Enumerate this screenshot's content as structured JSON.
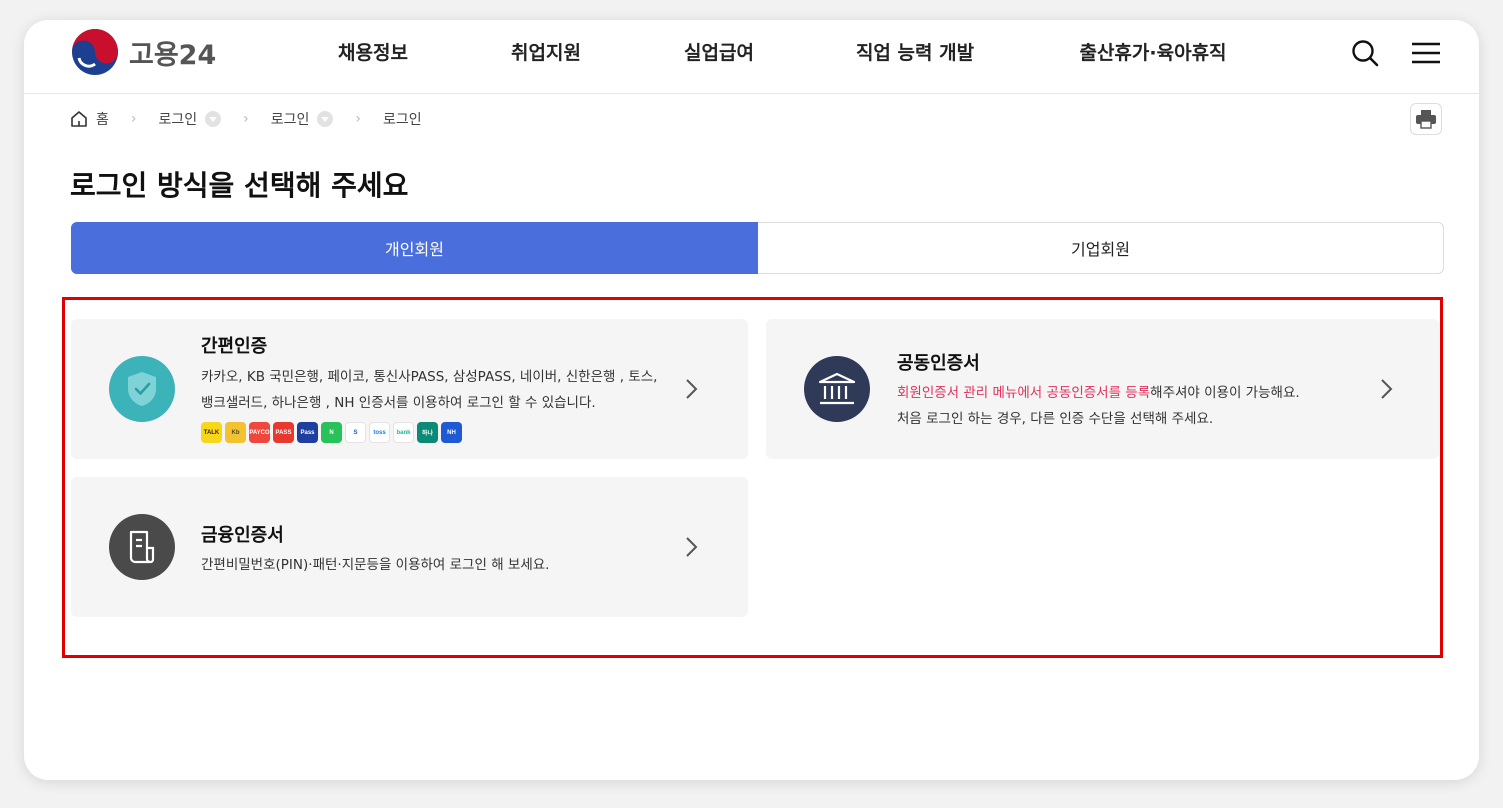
{
  "header": {
    "logo_text": "고용24",
    "nav": [
      "채용정보",
      "취업지원",
      "실업급여",
      "직업 능력 개발",
      "출산휴가·육아휴직"
    ],
    "icons": [
      "search-icon",
      "menu-icon"
    ]
  },
  "breadcrumb": {
    "home": "홈",
    "items": [
      "로그인",
      "로그인",
      "로그인"
    ]
  },
  "page_title": "로그인 방식을 선택해 주세요",
  "tabs": [
    {
      "label": "개인회원",
      "active": true
    },
    {
      "label": "기업회원",
      "active": false
    }
  ],
  "cards": {
    "simple": {
      "title": "간편인증",
      "desc": "카카오, KB 국민은행, 페이코, 통신사PASS, 삼성PASS, 네이버, 신한은행 , 토스, 뱅크샐러드, 하나은행 , NH 인증서를 이용하여 로그인 할 수 있습니다.",
      "badges": [
        {
          "label": "TALK",
          "color": "#f7d71c",
          "text_color": "#3a1d1d"
        },
        {
          "label": "Kb",
          "color": "#f2c230",
          "text_color": "#5a4a1a"
        },
        {
          "label": "PAYCO",
          "color": "#f0463c",
          "text_color": "#ffffff"
        },
        {
          "label": "PASS",
          "color": "#e8392e",
          "text_color": "#ffffff"
        },
        {
          "label": "Pass",
          "color": "#1e3fa0",
          "text_color": "#ffffff"
        },
        {
          "label": "N",
          "color": "#27c35a",
          "text_color": "#ffffff"
        },
        {
          "label": "S",
          "color": "#ffffff",
          "text_color": "#1a56d6"
        },
        {
          "label": "toss",
          "color": "#ffffff",
          "text_color": "#1a7ce8"
        },
        {
          "label": "bank",
          "color": "#ffffff",
          "text_color": "#1fb5a0"
        },
        {
          "label": "하나",
          "color": "#0c8a78",
          "text_color": "#ffffff"
        },
        {
          "label": "NH",
          "color": "#1d5ad4",
          "text_color": "#ffffff"
        }
      ]
    },
    "joint": {
      "title": "공동인증서",
      "desc_highlight": "회원인증서 관리 메뉴에서 공동인증서를 등록",
      "desc_rest": "해주셔야 이용이 가능해요.",
      "desc_line2": "처음 로그인 하는 경우, 다른 인증 수단을 선택해 주세요."
    },
    "financial": {
      "title": "금융인증서",
      "desc": "간편비밀번호(PIN)·패턴·지문등을 이용하여 로그인 해 보세요."
    }
  },
  "colors": {
    "primary": "#4a6fdc",
    "highlight_border": "#e00000",
    "accent_text": "#e0305a",
    "simple_icon_bg": "#3bb3b8",
    "joint_icon_bg": "#2f3a58",
    "financial_icon_bg": "#4a4a4a"
  }
}
